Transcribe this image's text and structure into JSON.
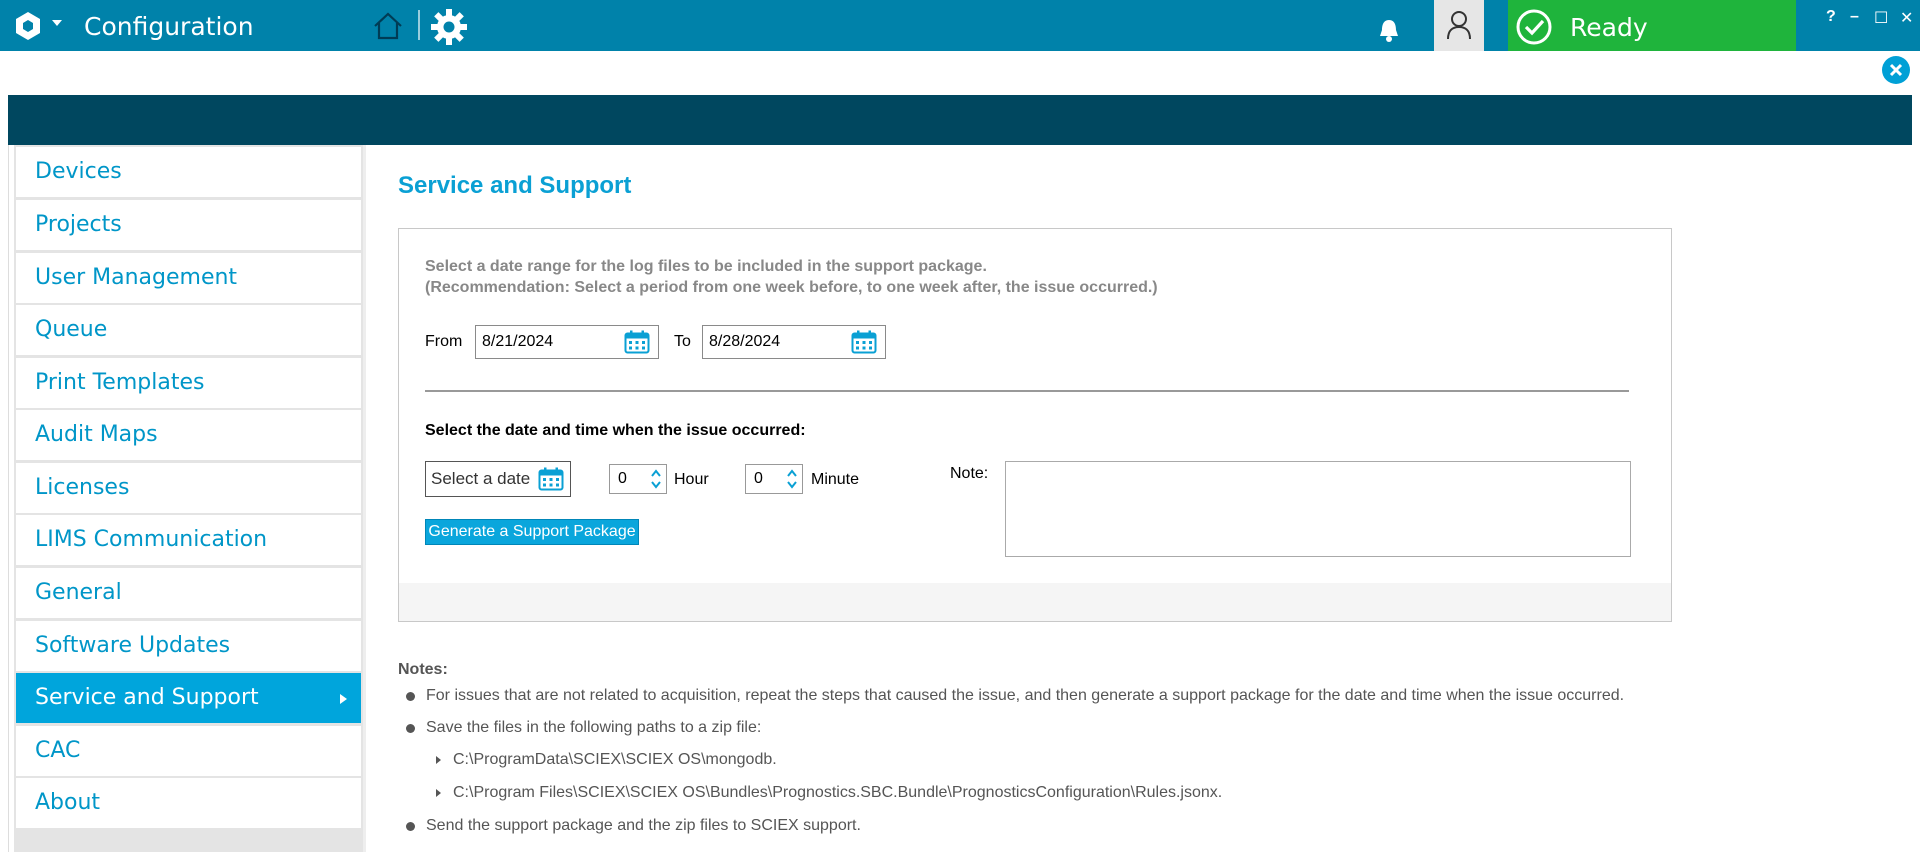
{
  "header": {
    "app_title": "Configuration",
    "status_label": "Ready",
    "window_controls": {
      "help": "?",
      "minimize": "–",
      "maximize": "☐",
      "close": "✕"
    },
    "colors": {
      "bar": "#0082aa",
      "ready": "#1fb43c",
      "dark_band": "#00475f",
      "accent": "#00a5dc"
    }
  },
  "sidebar": {
    "items": [
      {
        "label": "Devices",
        "active": false
      },
      {
        "label": "Projects",
        "active": false
      },
      {
        "label": "User Management",
        "active": false
      },
      {
        "label": "Queue",
        "active": false
      },
      {
        "label": "Print Templates",
        "active": false
      },
      {
        "label": "Audit Maps",
        "active": false
      },
      {
        "label": "Licenses",
        "active": false
      },
      {
        "label": "LIMS Communication",
        "active": false
      },
      {
        "label": "General",
        "active": false
      },
      {
        "label": "Software Updates",
        "active": false
      },
      {
        "label": "Service and Support",
        "active": true
      },
      {
        "label": "CAC",
        "active": false
      },
      {
        "label": "About",
        "active": false
      }
    ]
  },
  "main": {
    "title": "Service and Support",
    "range": {
      "instruction_1": "Select a date range for the log files to be included in the support package.",
      "instruction_2": "(Recommendation: Select a period from one week before, to one week after, the issue occurred.)",
      "from_label": "From",
      "from_value": "8/21/2024",
      "to_label": "To",
      "to_value": "8/28/2024"
    },
    "issue": {
      "heading": "Select the date and time when the issue occurred:",
      "date_placeholder": "Select a date",
      "hour_value": "0",
      "hour_label": "Hour",
      "minute_value": "0",
      "minute_label": "Minute",
      "note_label": "Note:",
      "note_value": "",
      "generate_label": "Generate a Support Package"
    },
    "notes": {
      "title": "Notes:",
      "items": [
        "For issues that are not related to acquisition, repeat the steps that caused the issue, and then generate a support package for the date and time when the issue occurred.",
        "Save the files in the following paths to a zip file:",
        "Send the support package and the zip files to SCIEX support."
      ],
      "paths": [
        "C:\\ProgramData\\SCIEX\\SCIEX OS\\mongodb.",
        "C:\\Program Files\\SCIEX\\SCIEX OS\\Bundles\\Prognostics.SBC.Bundle\\PrognosticsConfiguration\\Rules.jsonx."
      ]
    }
  }
}
